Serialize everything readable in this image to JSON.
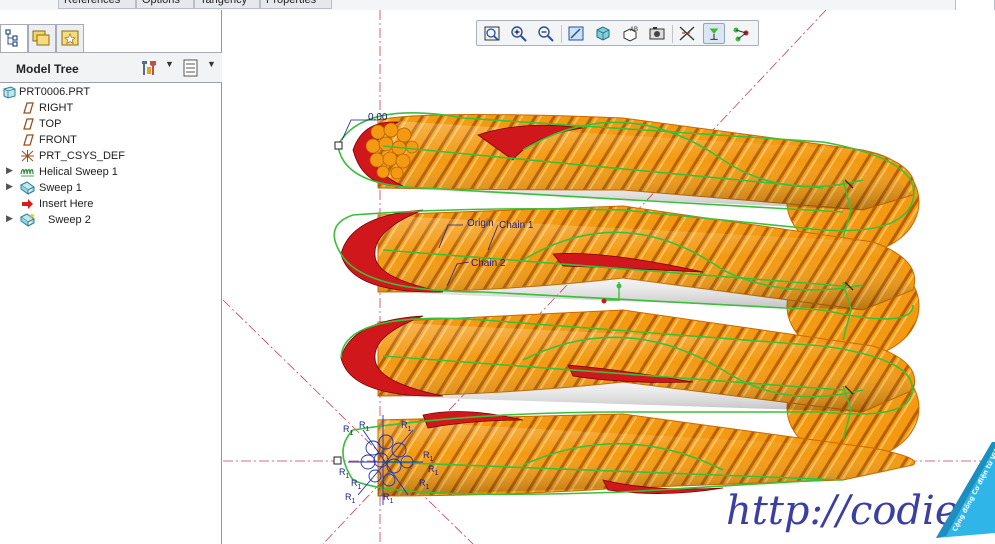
{
  "top_tabs": [
    "References",
    "Options",
    "Tangency",
    "Properties"
  ],
  "model_tree": {
    "title": "Model Tree",
    "items": [
      {
        "label": "PRT0006.PRT",
        "icon": "part-icon"
      },
      {
        "label": "RIGHT",
        "icon": "datum-plane-icon"
      },
      {
        "label": "TOP",
        "icon": "datum-plane-icon"
      },
      {
        "label": "FRONT",
        "icon": "datum-plane-icon"
      },
      {
        "label": "PRT_CSYS_DEF",
        "icon": "coordinate-system-icon"
      },
      {
        "label": "Helical Sweep 1",
        "icon": "helical-sweep-icon"
      },
      {
        "label": "Sweep 1",
        "icon": "sweep-icon"
      },
      {
        "label": "Insert Here",
        "icon": "insert-here-arrow-icon"
      },
      {
        "label": "Sweep 2",
        "icon": "sweep-icon"
      }
    ]
  },
  "view_toolbar": {
    "buttons": [
      "refit-icon",
      "zoom-in-icon",
      "zoom-out-icon",
      "repaint-icon",
      "display-style-icon",
      "saved-views-icon",
      "view-manager-icon",
      "datum-display-icon",
      "spin-center-icon",
      "annotation-display-icon"
    ],
    "active": [
      "spin-center-icon"
    ]
  },
  "scene": {
    "dimension_value": "0.00",
    "labels": {
      "origin": "Origin",
      "chain1": "Chain 1",
      "chain2": "Chain 2",
      "radius": "R",
      "radius_sub": "1"
    },
    "colors": {
      "rope": "#f39a12",
      "rope_dark": "#c86a00",
      "interior": "#d0181c",
      "trajectory": "#3bbf3b",
      "datum": "#c8405a"
    }
  },
  "watermark": "http://codientu.org",
  "badge_text": "Cộng đồng Cơ điện tử Việt Nam"
}
